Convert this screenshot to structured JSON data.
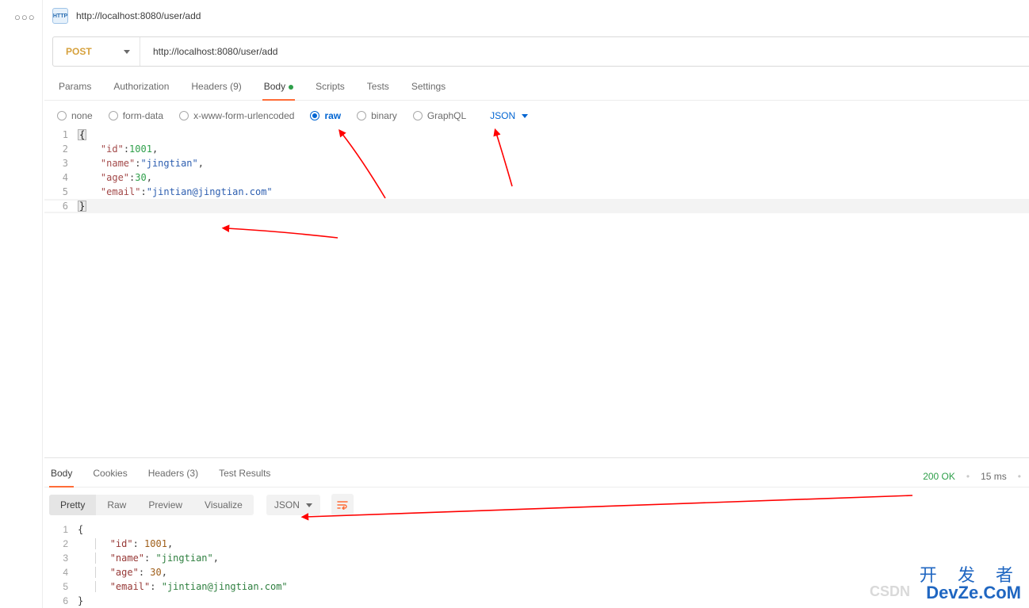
{
  "title_url": "http://localhost:8080/user/add",
  "http_badge": "HTTP",
  "method": "POST",
  "url": "http://localhost:8080/user/add",
  "req_tabs": {
    "params": "Params",
    "authorization": "Authorization",
    "headers": "Headers (9)",
    "body": "Body",
    "scripts": "Scripts",
    "tests": "Tests",
    "settings": "Settings"
  },
  "body_types": {
    "none": "none",
    "form_data": "form-data",
    "x_www": "x-www-form-urlencoded",
    "raw": "raw",
    "binary": "binary",
    "graphql": "GraphQL"
  },
  "raw_format": "JSON",
  "request_body": {
    "id_key": "\"id\"",
    "id_val": "1001",
    "name_key": "\"name\"",
    "name_val": "\"jingtian\"",
    "age_key": "\"age\"",
    "age_val": "30",
    "email_key": "\"email\"",
    "email_val": "\"jintian@jingtian.com\"",
    "open": "{",
    "close": "}",
    "ln1": "1",
    "ln2": "2",
    "ln3": "3",
    "ln4": "4",
    "ln5": "5",
    "ln6": "6"
  },
  "response_tabs": {
    "body": "Body",
    "cookies": "Cookies",
    "headers": "Headers (3)",
    "testresults": "Test Results"
  },
  "response_meta": {
    "status": "200 OK",
    "time": "15 ms"
  },
  "res_views": {
    "pretty": "Pretty",
    "raw": "Raw",
    "preview": "Preview",
    "visualize": "Visualize",
    "format": "JSON"
  },
  "response_body": {
    "open": "{",
    "close": "}",
    "id_key": "\"id\"",
    "id_val": "1001",
    "name_key": "\"name\"",
    "name_val": "\"jingtian\"",
    "age_key": "\"age\"",
    "age_val": "30",
    "email_key": "\"email\"",
    "email_val": "\"jintian@jingtian.com\"",
    "ln1": "1",
    "ln2": "2",
    "ln3": "3",
    "ln4": "4",
    "ln5": "5",
    "ln6": "6"
  },
  "watermark": {
    "cn": "开 发 者",
    "en": "DevZe.CoM",
    "csdn": "CSDN"
  }
}
